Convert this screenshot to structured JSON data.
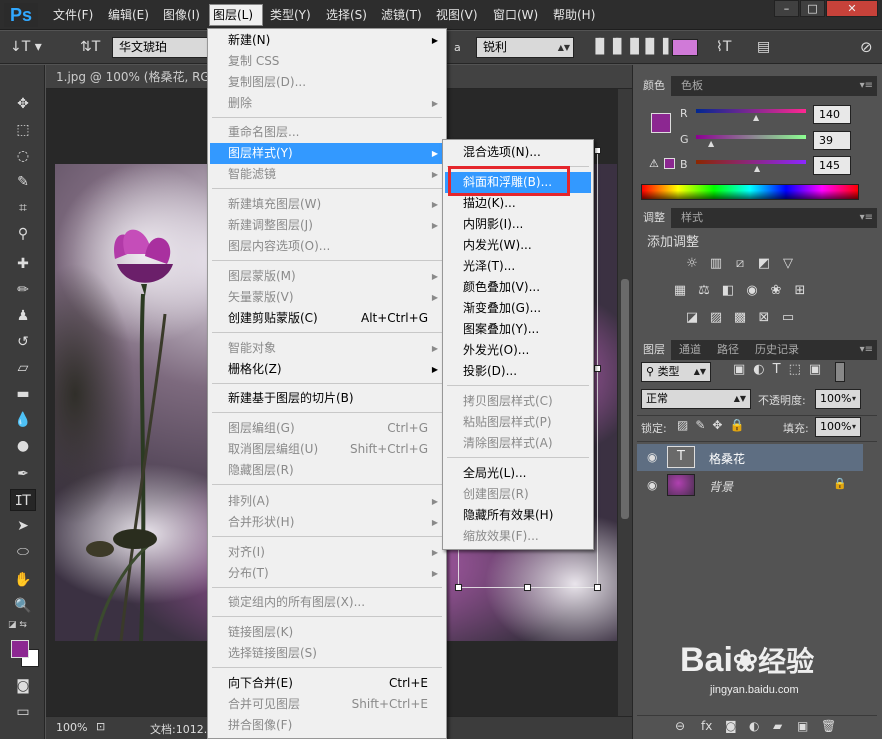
{
  "menubar": {
    "logo": "Ps",
    "items": [
      "文件(F)",
      "编辑(E)",
      "图像(I)",
      "图层(L)",
      "类型(Y)",
      "选择(S)",
      "滤镜(T)",
      "视图(V)",
      "窗口(W)",
      "帮助(H)"
    ],
    "window_controls": [
      "–",
      "□",
      "✕"
    ]
  },
  "options": {
    "font_family": "华文琥珀",
    "aa_label": "a",
    "aa_mode": "锐利"
  },
  "document": {
    "tab_title": "1.jpg @ 100% (格桑花, RGB/8)",
    "zoom": "100%",
    "status": "文档:1012..."
  },
  "layer_menu": {
    "items": [
      {
        "label": "新建(N)",
        "shortcut": "",
        "submenu": true,
        "disabled": false
      },
      {
        "label": "复制 CSS",
        "shortcut": "",
        "submenu": false,
        "disabled": true
      },
      {
        "label": "复制图层(D)...",
        "shortcut": "",
        "submenu": false,
        "disabled": true
      },
      {
        "label": "删除",
        "shortcut": "",
        "submenu": true,
        "disabled": true
      },
      {
        "label": "重命名图层...",
        "shortcut": "",
        "submenu": false,
        "disabled": true
      },
      {
        "label": "图层样式(Y)",
        "shortcut": "",
        "submenu": true,
        "disabled": false,
        "highlight": true
      },
      {
        "label": "智能滤镜",
        "shortcut": "",
        "submenu": true,
        "disabled": true
      },
      {
        "label": "新建填充图层(W)",
        "shortcut": "",
        "submenu": true,
        "disabled": true
      },
      {
        "label": "新建调整图层(J)",
        "shortcut": "",
        "submenu": true,
        "disabled": true
      },
      {
        "label": "图层内容选项(O)...",
        "shortcut": "",
        "submenu": false,
        "disabled": true
      },
      {
        "label": "图层蒙版(M)",
        "shortcut": "",
        "submenu": true,
        "disabled": true
      },
      {
        "label": "矢量蒙版(V)",
        "shortcut": "",
        "submenu": true,
        "disabled": true
      },
      {
        "label": "创建剪贴蒙版(C)",
        "shortcut": "Alt+Ctrl+G",
        "submenu": false,
        "disabled": false
      },
      {
        "label": "智能对象",
        "shortcut": "",
        "submenu": true,
        "disabled": true
      },
      {
        "label": "栅格化(Z)",
        "shortcut": "",
        "submenu": true,
        "disabled": false
      },
      {
        "label": "新建基于图层的切片(B)",
        "shortcut": "",
        "submenu": false,
        "disabled": false
      },
      {
        "label": "图层编组(G)",
        "shortcut": "Ctrl+G",
        "submenu": false,
        "disabled": true
      },
      {
        "label": "取消图层编组(U)",
        "shortcut": "Shift+Ctrl+G",
        "submenu": false,
        "disabled": true
      },
      {
        "label": "隐藏图层(R)",
        "shortcut": "",
        "submenu": false,
        "disabled": true
      },
      {
        "label": "排列(A)",
        "shortcut": "",
        "submenu": true,
        "disabled": true
      },
      {
        "label": "合并形状(H)",
        "shortcut": "",
        "submenu": true,
        "disabled": true
      },
      {
        "label": "对齐(I)",
        "shortcut": "",
        "submenu": true,
        "disabled": true
      },
      {
        "label": "分布(T)",
        "shortcut": "",
        "submenu": true,
        "disabled": true
      },
      {
        "label": "锁定组内的所有图层(X)...",
        "shortcut": "",
        "submenu": false,
        "disabled": true
      },
      {
        "label": "链接图层(K)",
        "shortcut": "",
        "submenu": false,
        "disabled": true
      },
      {
        "label": "选择链接图层(S)",
        "shortcut": "",
        "submenu": false,
        "disabled": true
      },
      {
        "label": "向下合并(E)",
        "shortcut": "Ctrl+E",
        "submenu": false,
        "disabled": false
      },
      {
        "label": "合并可见图层",
        "shortcut": "Shift+Ctrl+E",
        "submenu": false,
        "disabled": true
      },
      {
        "label": "拼合图像(F)",
        "shortcut": "",
        "submenu": false,
        "disabled": true
      }
    ]
  },
  "style_menu": {
    "items": [
      {
        "label": "混合选项(N)...",
        "disabled": false
      },
      {
        "label": "斜面和浮雕(B)...",
        "disabled": false,
        "highlight": true
      },
      {
        "label": "描边(K)...",
        "disabled": false
      },
      {
        "label": "内阴影(I)...",
        "disabled": false
      },
      {
        "label": "内发光(W)...",
        "disabled": false
      },
      {
        "label": "光泽(T)...",
        "disabled": false
      },
      {
        "label": "颜色叠加(V)...",
        "disabled": false
      },
      {
        "label": "渐变叠加(G)...",
        "disabled": false
      },
      {
        "label": "图案叠加(Y)...",
        "disabled": false
      },
      {
        "label": "外发光(O)...",
        "disabled": false
      },
      {
        "label": "投影(D)...",
        "disabled": false
      },
      {
        "label": "拷贝图层样式(C)",
        "disabled": true
      },
      {
        "label": "粘贴图层样式(P)",
        "disabled": true
      },
      {
        "label": "清除图层样式(A)",
        "disabled": true
      },
      {
        "label": "全局光(L)...",
        "disabled": false
      },
      {
        "label": "创建图层(R)",
        "disabled": true
      },
      {
        "label": "隐藏所有效果(H)",
        "disabled": false
      },
      {
        "label": "缩放效果(F)...",
        "disabled": true
      }
    ]
  },
  "color_panel": {
    "tabs": [
      "颜色",
      "色板"
    ],
    "channels": [
      {
        "label": "R",
        "value": "140"
      },
      {
        "label": "G",
        "value": "39"
      },
      {
        "label": "B",
        "value": "145"
      }
    ],
    "foreground": "#8c2791"
  },
  "adjust_panel": {
    "tabs": [
      "调整",
      "样式"
    ],
    "title": "添加调整"
  },
  "layers_panel": {
    "tabs": [
      "图层",
      "通道",
      "路径",
      "历史记录"
    ],
    "filter": "类型",
    "blend_mode": "正常",
    "opacity_label": "不透明度:",
    "opacity": "100%",
    "lock_label": "锁定:",
    "fill_label": "填充:",
    "fill": "100%",
    "layers": [
      {
        "name": "格桑花",
        "type": "text",
        "selected": true
      },
      {
        "name": "背景",
        "type": "image",
        "selected": false
      }
    ]
  },
  "watermark": {
    "brand": "Bai",
    "brand2": "经验",
    "site": "jingyan.baidu.com"
  }
}
